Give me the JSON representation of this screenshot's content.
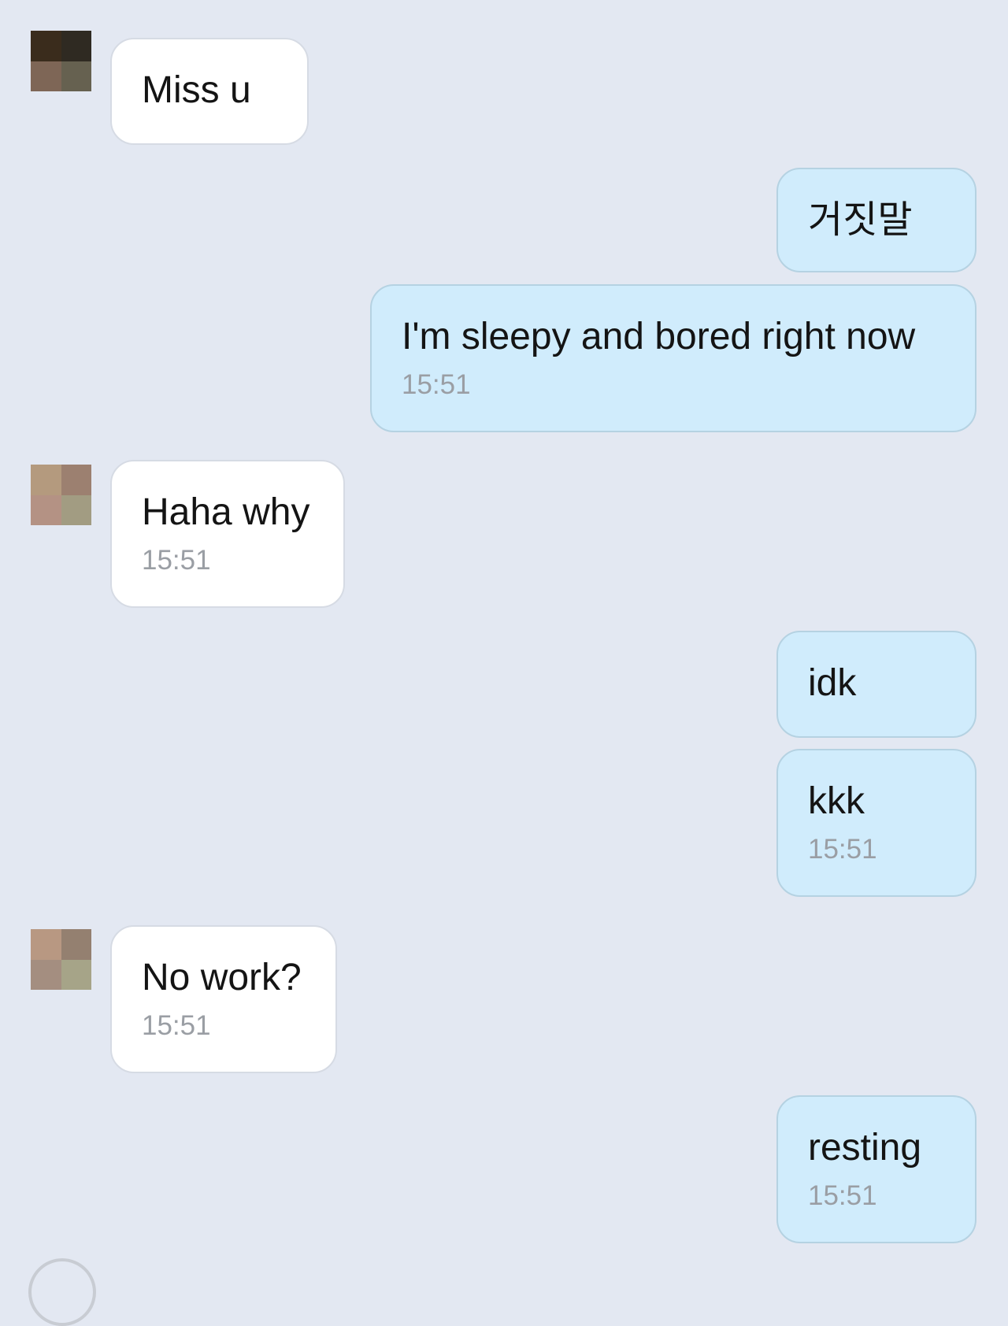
{
  "colors": {
    "background": "#e3e8f2",
    "incoming_bubble": "#ffffff",
    "outgoing_bubble": "#d0ecfc",
    "text": "#141414",
    "timestamp": "#9a9ea4"
  },
  "messages": [
    {
      "sender": "contact",
      "text": "Miss u",
      "time": ""
    },
    {
      "sender": "me",
      "text": "거짓말",
      "time": ""
    },
    {
      "sender": "me",
      "text": "I'm sleepy and bored right now",
      "time": "15:51"
    },
    {
      "sender": "contact",
      "text": "Haha why",
      "time": "15:51"
    },
    {
      "sender": "me",
      "text": "idk",
      "time": ""
    },
    {
      "sender": "me",
      "text": "kkk",
      "time": "15:51"
    },
    {
      "sender": "contact",
      "text": "No work?",
      "time": "15:51"
    },
    {
      "sender": "me",
      "text": "resting",
      "time": "15:51"
    }
  ],
  "avatars": [
    {
      "icon": "contact-avatar-icon",
      "pixelated": true
    },
    {
      "icon": "contact-avatar-icon",
      "pixelated": true
    },
    {
      "icon": "contact-avatar-icon",
      "pixelated": true
    }
  ]
}
